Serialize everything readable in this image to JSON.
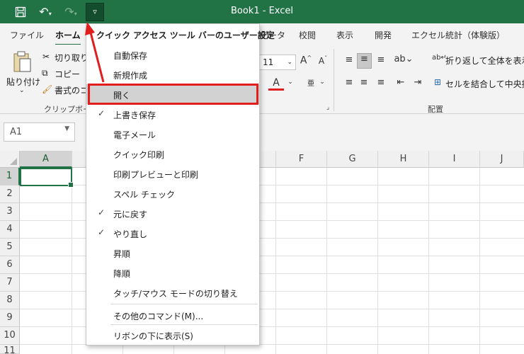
{
  "titlebar": {
    "title": "Book1  -  Excel",
    "save_icon": "save-icon",
    "undo_icon": "undo-icon",
    "redo_icon": "redo-icon",
    "customize_icon": "customize-qat-icon"
  },
  "tabs": [
    "ファイル",
    "ホーム",
    "データ",
    "校閲",
    "表示",
    "開発",
    "エクセル統計（体験版）"
  ],
  "ribbon": {
    "paste_label": "貼り付け",
    "cut_label": "切り取り",
    "copy_label": "コピー",
    "format_painter_label": "書式のコ",
    "clipboard_group": "クリップボード",
    "font_size": "11",
    "wrap_text_label": "折り返して全体を表示す",
    "merge_center_label": "セルを結合して中央揃え",
    "alignment_group": "配置"
  },
  "name_box": {
    "value": "A1"
  },
  "grid": {
    "columns": [
      "A",
      "",
      "",
      "",
      "F",
      "G",
      "H",
      "I",
      "J"
    ],
    "rows": [
      "1",
      "2",
      "3",
      "4",
      "5",
      "6",
      "7",
      "8",
      "9",
      "10",
      "11"
    ]
  },
  "menu": {
    "header": "クイック アクセス ツール バーのユーザー設定",
    "items": [
      {
        "label": "自動保存",
        "checked": false
      },
      {
        "label": "新規作成",
        "checked": false
      },
      {
        "label": "開く",
        "checked": false,
        "highlighted": true
      },
      {
        "label": "上書き保存",
        "checked": true
      },
      {
        "label": "電子メール",
        "checked": false
      },
      {
        "label": "クイック印刷",
        "checked": false
      },
      {
        "label": "印刷プレビューと印刷",
        "checked": false
      },
      {
        "label": "スペル チェック",
        "checked": false
      },
      {
        "label": "元に戻す",
        "checked": true
      },
      {
        "label": "やり直し",
        "checked": true
      },
      {
        "label": "昇順",
        "checked": false
      },
      {
        "label": "降順",
        "checked": false
      },
      {
        "label": "タッチ/マウス モードの切り替え",
        "checked": false
      }
    ],
    "more_commands": "その他のコマンド(M)...",
    "show_below": "リボンの下に表示(S)"
  },
  "colors": {
    "accent": "#217346",
    "annotation": "#e21d1d"
  }
}
